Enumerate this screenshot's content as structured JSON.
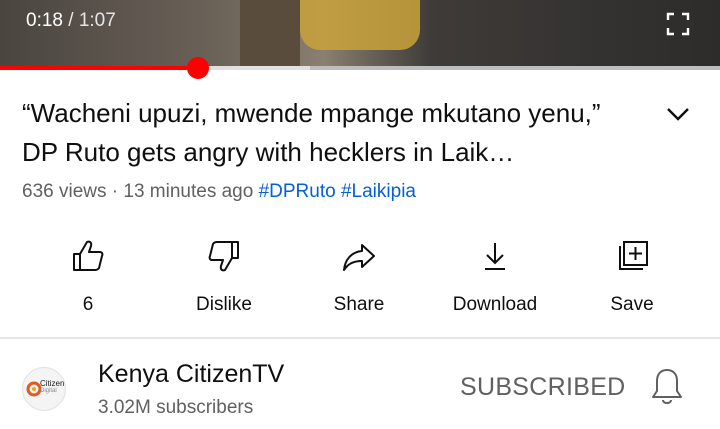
{
  "player": {
    "current_time": "0:18",
    "duration": "1:07",
    "progress": 0.275,
    "buffered": 0.43,
    "accent_color": "#ff0000"
  },
  "video": {
    "title": "“Wacheni upuzi, mwende mpange mkutano yenu,” DP Ruto gets angry with hecklers in Laik…",
    "views": "636 views",
    "age": "13 minutes ago",
    "hashtags": [
      "#DPRuto",
      "#Laikipia"
    ]
  },
  "actions": {
    "like_count": "6",
    "dislike_label": "Dislike",
    "share_label": "Share",
    "download_label": "Download",
    "save_label": "Save"
  },
  "channel": {
    "name": "Kenya CitizenTV",
    "subscribers": "3.02M subscribers",
    "logo_text": "Citizen",
    "logo_sub": "Digital",
    "subscribe_state": "SUBSCRIBED"
  },
  "icons": {
    "fullscreen": "fullscreen-icon",
    "expand": "chevron-down-icon",
    "like": "thumbs-up-icon",
    "dislike": "thumbs-down-icon",
    "share": "share-arrow-icon",
    "download": "download-icon",
    "save": "playlist-add-icon",
    "bell": "bell-icon"
  }
}
